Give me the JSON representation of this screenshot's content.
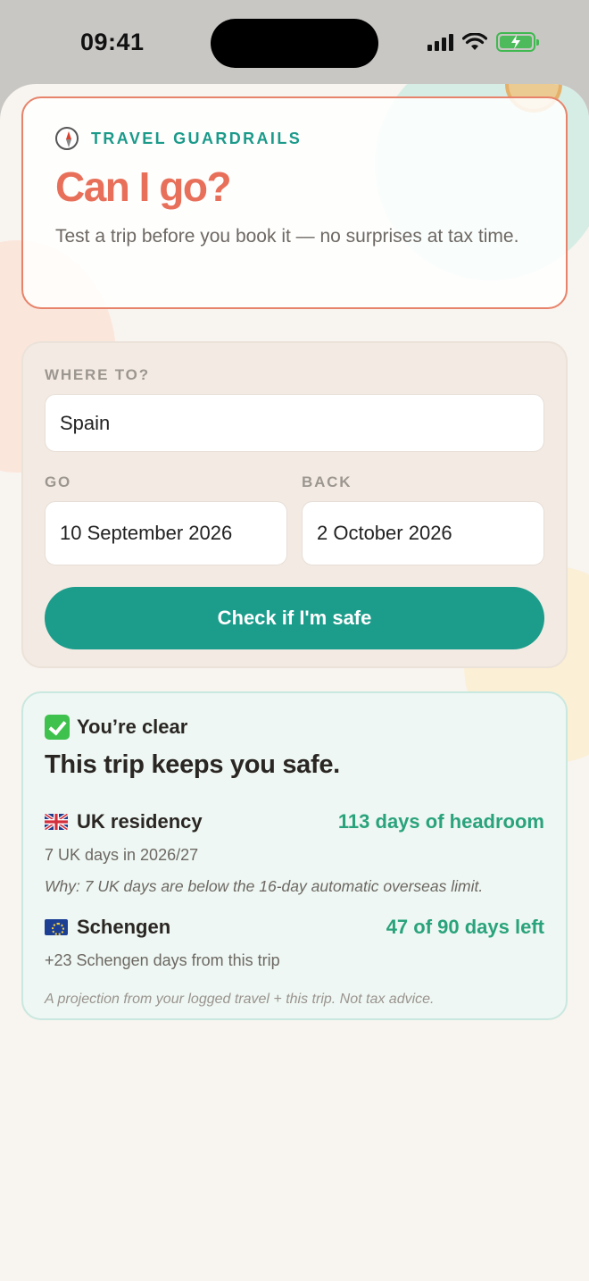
{
  "status_bar": {
    "time": "09:41"
  },
  "header": {
    "eyebrow": "TRAVEL GUARDRAILS",
    "eyebrow_icon": "compass-icon",
    "title": "Can I go?",
    "subtitle": "Test a trip before you book it — no surprises at tax time."
  },
  "form": {
    "destination_label": "WHERE TO?",
    "destination_value": "Spain",
    "go_label": "GO",
    "go_value": "10 September 2026",
    "back_label": "BACK",
    "back_value": "2 October 2026",
    "button_label": "Check if I'm safe"
  },
  "result": {
    "status_icon": "check-box-icon",
    "status": "You’re clear",
    "title": "This trip keeps you safe.",
    "uk": {
      "flag": "uk-flag-icon",
      "name": "UK residency",
      "value": "113 days of headroom",
      "detail": "7 UK days in 2026/27",
      "why": "Why: 7 UK days are below the 16-day automatic overseas limit."
    },
    "schengen": {
      "flag": "eu-flag-icon",
      "name": "Schengen",
      "value": "47 of 90 days left",
      "detail": "+23 Schengen days from this trip"
    },
    "disclaimer": "A projection from your logged travel + this trip. Not tax advice."
  },
  "colors": {
    "accent_teal": "#1c9c8b",
    "title_coral": "#e8705a",
    "success_green": "#2aa37c"
  }
}
